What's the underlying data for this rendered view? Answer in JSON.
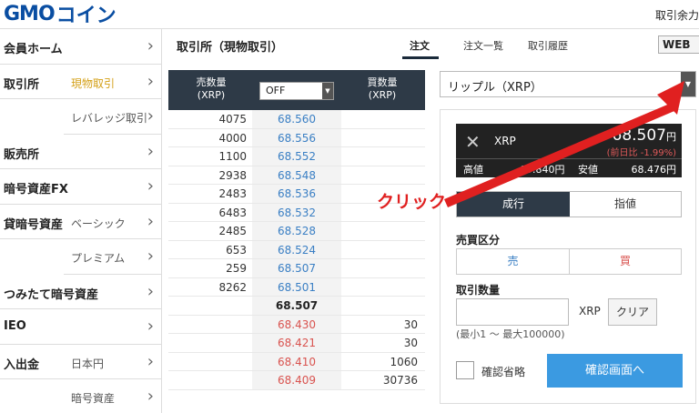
{
  "header": {
    "logo_gmo": "GMO",
    "logo_coin": "コイン",
    "right_text": "取引余力"
  },
  "sidebar": {
    "items": [
      {
        "main": "会員ホーム",
        "sub": ""
      },
      {
        "main": "取引所",
        "sub": "現物取引"
      },
      {
        "main": "",
        "sub": "レバレッジ取引"
      },
      {
        "main": "販売所",
        "sub": ""
      },
      {
        "main": "暗号資産FX",
        "sub": ""
      },
      {
        "main": "貸暗号資産",
        "sub": "ベーシック"
      },
      {
        "main": "",
        "sub": "プレミアム"
      },
      {
        "main": "つみたて暗号資産",
        "sub": ""
      },
      {
        "main": "IEO",
        "sub": ""
      },
      {
        "main": "入出金",
        "sub": "日本円"
      },
      {
        "main": "",
        "sub": "暗号資産"
      }
    ]
  },
  "main": {
    "title": "取引所（現物取引）",
    "tabs": [
      "注文",
      "注文一覧",
      "取引履歴"
    ],
    "web_badge": "WEB"
  },
  "book": {
    "head_sell": "売数量",
    "head_sell_unit": "(XRP)",
    "head_buy": "買数量",
    "head_buy_unit": "(XRP)",
    "select_value": "OFF",
    "rows": [
      {
        "sell": "4075",
        "price": "68.560",
        "buy": "",
        "kind": "ask"
      },
      {
        "sell": "4000",
        "price": "68.556",
        "buy": "",
        "kind": "ask"
      },
      {
        "sell": "1100",
        "price": "68.552",
        "buy": "",
        "kind": "ask"
      },
      {
        "sell": "2938",
        "price": "68.548",
        "buy": "",
        "kind": "ask"
      },
      {
        "sell": "2483",
        "price": "68.536",
        "buy": "",
        "kind": "ask"
      },
      {
        "sell": "6483",
        "price": "68.532",
        "buy": "",
        "kind": "ask"
      },
      {
        "sell": "2485",
        "price": "68.528",
        "buy": "",
        "kind": "ask"
      },
      {
        "sell": "653",
        "price": "68.524",
        "buy": "",
        "kind": "ask"
      },
      {
        "sell": "259",
        "price": "68.507",
        "buy": "",
        "kind": "ask"
      },
      {
        "sell": "8262",
        "price": "68.501",
        "buy": "",
        "kind": "ask"
      },
      {
        "sell": "",
        "price": "68.507",
        "buy": "",
        "kind": "mid"
      },
      {
        "sell": "",
        "price": "68.430",
        "buy": "30",
        "kind": "bid"
      },
      {
        "sell": "",
        "price": "68.421",
        "buy": "30",
        "kind": "bid"
      },
      {
        "sell": "",
        "price": "68.410",
        "buy": "1060",
        "kind": "bid"
      },
      {
        "sell": "",
        "price": "68.409",
        "buy": "30736",
        "kind": "bid"
      }
    ]
  },
  "order": {
    "pair": "リップル（XRP）",
    "symbol": "XRP",
    "price": "68.507",
    "price_unit": "円",
    "change": "(前日比 -1.99%)",
    "high_label": "高値",
    "high_value": "69.840円",
    "low_label": "安値",
    "low_value": "68.476円",
    "type_market": "成行",
    "type_limit": "指値",
    "side_label": "売買区分",
    "sell": "売",
    "buy": "買",
    "qty_label": "取引数量",
    "qty_unit": "XRP",
    "clear": "クリア",
    "qty_hint": "(最小1 〜 最大100000)",
    "skip_confirm": "確認省略",
    "confirm_button": "確認画面へ"
  },
  "annotation": {
    "text": "クリック",
    "color": "#e02020"
  },
  "colors": {
    "ask": "#3a7fc4",
    "bid": "#d9534f",
    "dark": "#2e3a47",
    "button": "#3b9ae1",
    "active_sub": "#d4a017"
  }
}
